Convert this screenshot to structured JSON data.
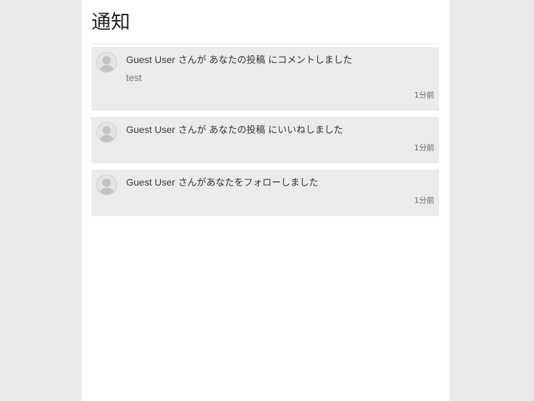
{
  "page": {
    "title": "通知"
  },
  "notifications": [
    {
      "user": "Guest User",
      "pre": " さんが ",
      "link": "あなたの投稿",
      "post": " にコメントしました",
      "comment": "test",
      "time": "1分前"
    },
    {
      "user": "Guest User",
      "pre": " さんが ",
      "link": "あなたの投稿",
      "post": " にいいねしました",
      "time": "1分前"
    },
    {
      "user": "Guest User",
      "pre": " さんがあなたをフォローしました",
      "time": "1分前"
    }
  ],
  "icons": {
    "avatar": "default-avatar-icon"
  },
  "colors": {
    "background": "#e9ebe9",
    "panel": "#ffffff",
    "item_background": "#eaebea"
  }
}
